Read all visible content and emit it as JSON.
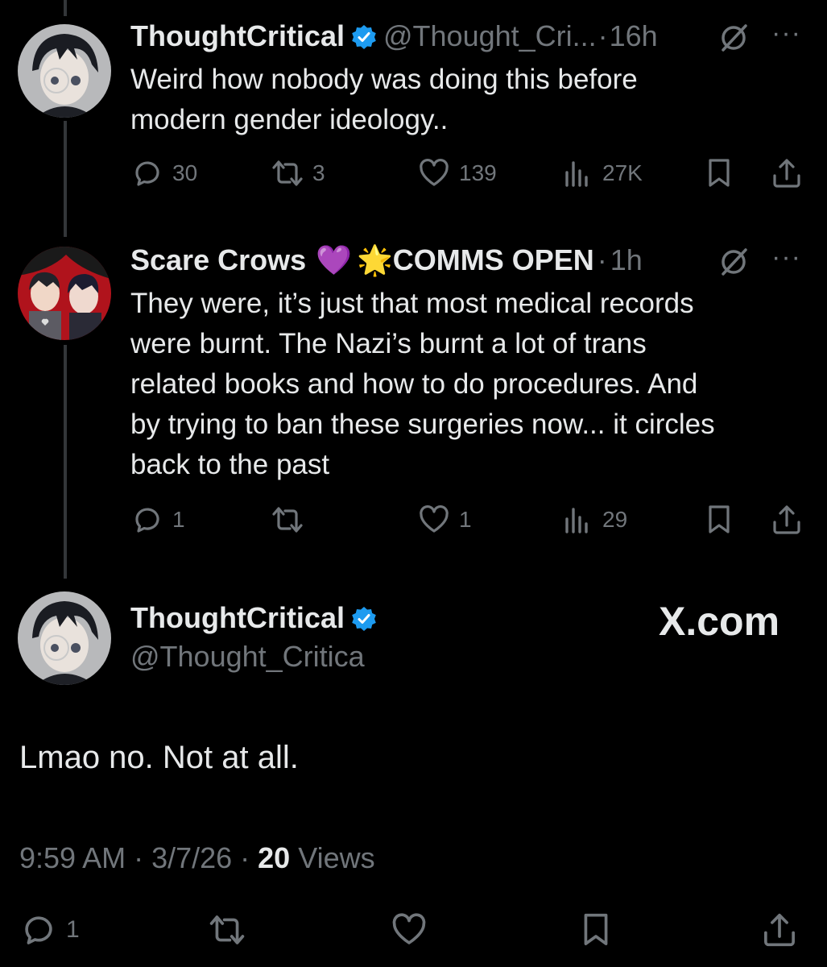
{
  "post1": {
    "name": "ThoughtCritical",
    "handle": "@Thought_Cri...",
    "separator": "·",
    "time": "16h",
    "more": "···",
    "text_lines": [
      "Weird how nobody was doing this before",
      "modern gender ideology.."
    ],
    "replies": "30",
    "reposts": "3",
    "likes": "139",
    "views": "27K",
    "avatar_icon": "anime-avatar-glasses"
  },
  "post2": {
    "name": "Scare Crows",
    "emoji": "💜",
    "star_emoji": "🌟",
    "tag": "COMMS OPEN",
    "separator": "·",
    "time": "1h",
    "more": "···",
    "text_lines": [
      "They were, it’s just that most medical records",
      "were burnt. The Nazi’s burnt a lot of trans",
      "related books and how to do procedures. And",
      "by trying to ban these surgeries now... it circles",
      "back to the past"
    ],
    "replies": "1",
    "reposts": "",
    "likes": "1",
    "views": "29",
    "avatar_icon": "anime-avatar-group"
  },
  "post3": {
    "name": "ThoughtCritical",
    "handle": "@Thought_Critica",
    "text": "Lmao no. Not at all.",
    "timestamp": "9:59 AM · 3/7/26 · ",
    "views_count": "20",
    "views_label": " Views",
    "replies": "1"
  },
  "watermark": "X.com",
  "colors": {
    "background": "#000000",
    "text": "#e7e9ea",
    "muted": "#71767b",
    "verified": "#1d9bf0"
  }
}
